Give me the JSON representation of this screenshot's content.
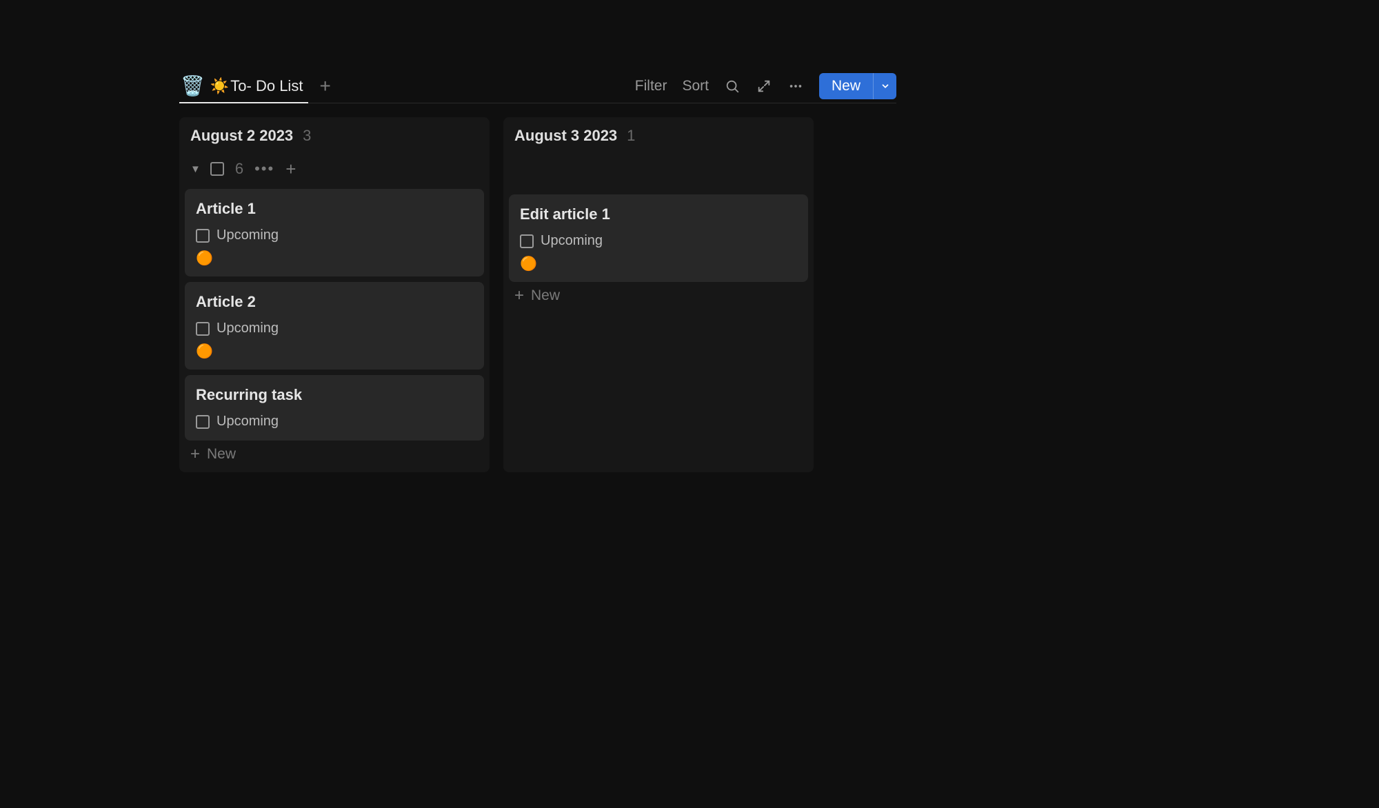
{
  "toolbar": {
    "tab": {
      "trash_icon": "🗑️",
      "sun_icon": "☀️",
      "title": "To- Do List"
    },
    "filter": "Filter",
    "sort": "Sort",
    "new": "New"
  },
  "columns": [
    {
      "title": "August 2 2023",
      "count": "3",
      "subheader": {
        "count": "6"
      },
      "cards": [
        {
          "title": "Article 1",
          "status": "Upcoming",
          "dot": "🟠"
        },
        {
          "title": "Article 2",
          "status": "Upcoming",
          "dot": "🟠"
        },
        {
          "title": "Recurring task",
          "status": "Upcoming",
          "dot": null
        }
      ],
      "new_label": "New"
    },
    {
      "title": "August 3 2023",
      "count": "1",
      "subheader": null,
      "cards": [
        {
          "title": "Edit article 1",
          "status": "Upcoming",
          "dot": "🟠"
        }
      ],
      "new_label": "New"
    }
  ]
}
